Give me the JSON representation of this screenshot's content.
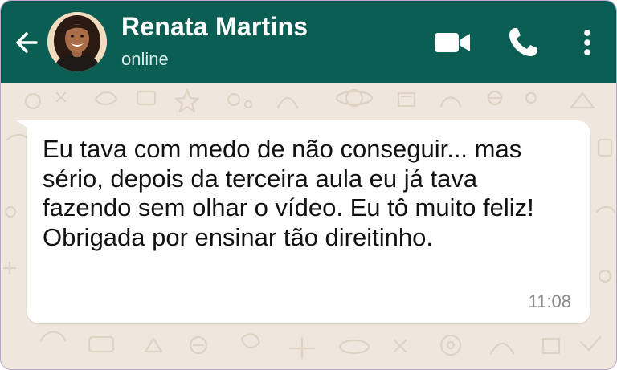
{
  "header": {
    "contact_name": "Renata Martins",
    "status": "online",
    "background_color": "#0b5e54",
    "icons": {
      "back": "arrow-left-icon",
      "video": "video-camera-icon",
      "call": "phone-icon",
      "menu": "more-vertical-icon"
    }
  },
  "chat": {
    "wallpaper_color": "#efe7dd",
    "messages": [
      {
        "direction": "incoming",
        "text": "Eu tava com medo de não conseguir... mas sério, depois da terceira aula eu já tava fazendo sem olhar o vídeo. Eu tô muito feliz! Obrigada por ensinar tão direitinho.",
        "time": "11:08"
      }
    ]
  }
}
